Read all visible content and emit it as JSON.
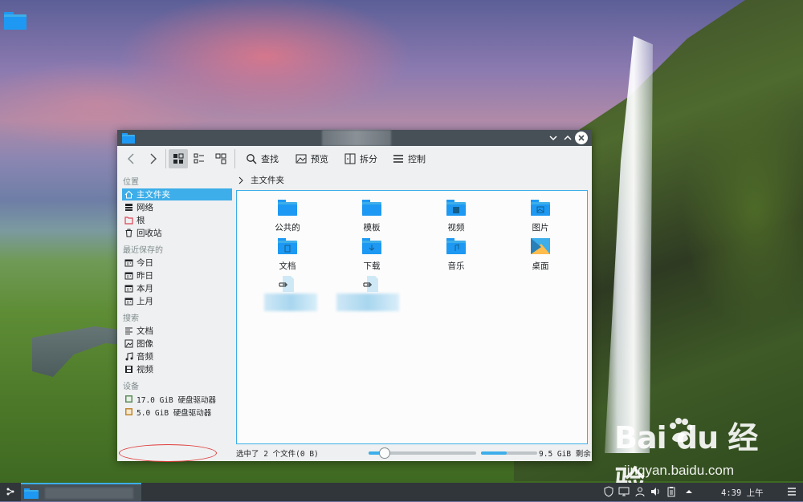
{
  "window": {
    "toolbar": {
      "find_label": "查找",
      "preview_label": "预览",
      "split_label": "拆分",
      "control_label": "控制"
    },
    "breadcrumb": {
      "current": "主文件夹"
    }
  },
  "sidebar": {
    "places_header": "位置",
    "places": [
      "主文件夹",
      "网络",
      "根",
      "回收站"
    ],
    "recent_header": "最近保存的",
    "recent": [
      "今日",
      "昨日",
      "本月",
      "上月"
    ],
    "search_header": "搜索",
    "search": [
      "文档",
      "图像",
      "音频",
      "视频"
    ],
    "devices_header": "设备",
    "devices": [
      "17.0 GiB 硬盘驱动器",
      "5.0 GiB 硬盘驱动器"
    ]
  },
  "files": [
    "公共的",
    "模板",
    "视频",
    "图片",
    "文档",
    "下载",
    "音乐",
    "桌面"
  ],
  "status": {
    "selection": "选中了 2 个文件(0 B)",
    "free_space": "9.5 GiB 剩余",
    "zoom_level": 0.14,
    "space_used": 0.45
  },
  "panel": {
    "clock": "4:39 上午"
  },
  "watermark": {
    "logo": "Bai du 经验",
    "url": "jingyan.baidu.com"
  },
  "colors": {
    "accent": "#3daee9",
    "titlebar": "#475057",
    "panel": "#31363b",
    "window_bg": "#eff0f1",
    "highlight_oval": "#e03a3a"
  }
}
